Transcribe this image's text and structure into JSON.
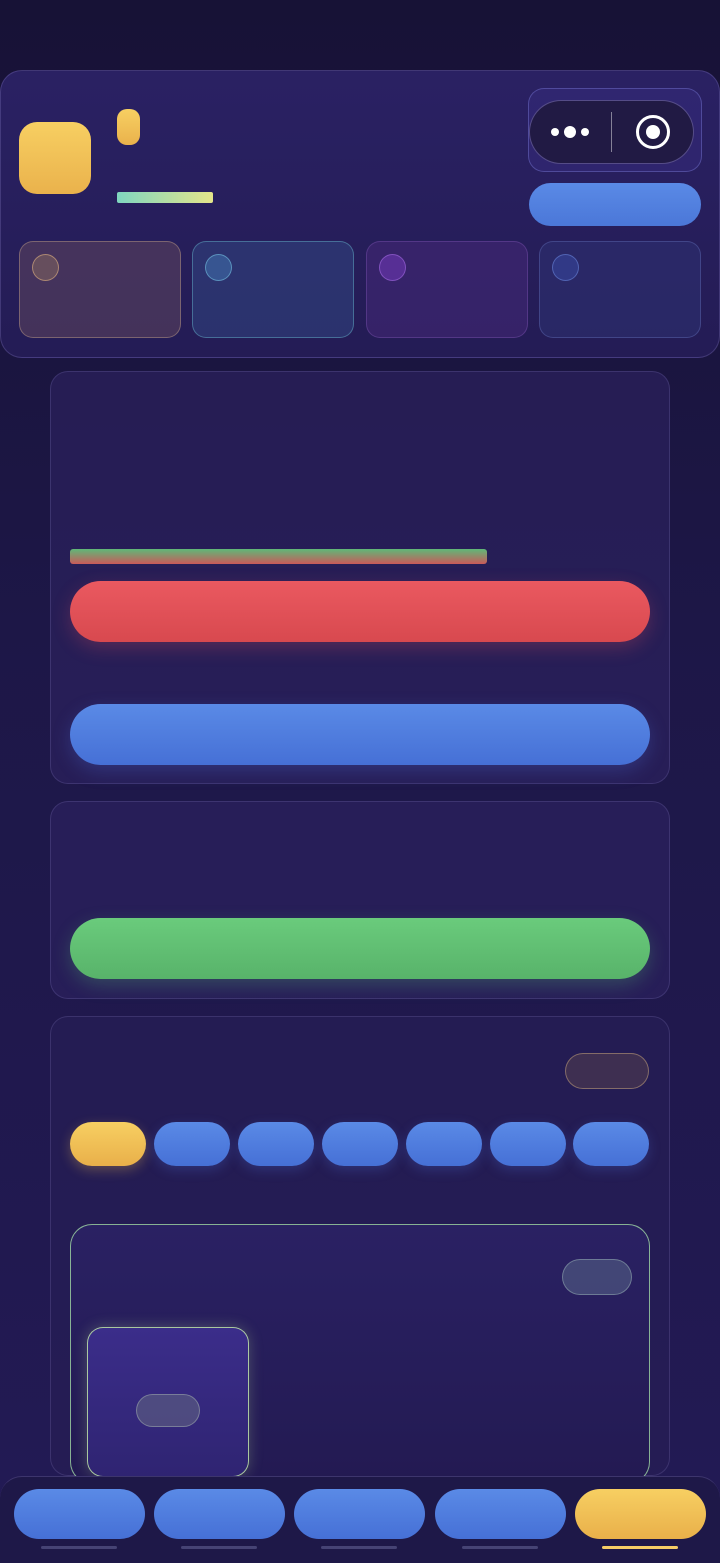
{
  "header": {
    "title": "",
    "action_label": "",
    "stats": [
      {
        "value": ""
      },
      {
        "value": ""
      },
      {
        "value": ""
      },
      {
        "value": ""
      }
    ]
  },
  "capsule": {
    "more_icon": "more-dots-icon",
    "close_icon": "target-circle-icon"
  },
  "task_panel": {
    "progress": 0.72,
    "primary_label": "",
    "secondary_label": ""
  },
  "reward_panel": {
    "button_label": ""
  },
  "schedule_panel": {
    "tag_label": "",
    "days": [
      {
        "label": "",
        "active": true
      },
      {
        "label": "",
        "active": false
      },
      {
        "label": "",
        "active": false
      },
      {
        "label": "",
        "active": false
      },
      {
        "label": "",
        "active": false
      },
      {
        "label": "",
        "active": false
      },
      {
        "label": "",
        "active": false
      }
    ],
    "card_tag": "",
    "slot_tag": ""
  },
  "tabs": [
    {
      "label": "",
      "active": false
    },
    {
      "label": "",
      "active": false
    },
    {
      "label": "",
      "active": false
    },
    {
      "label": "",
      "active": false
    },
    {
      "label": "",
      "active": true
    }
  ],
  "colors": {
    "accent_gold": "#f5c45a",
    "accent_blue": "#5282e0",
    "danger_red": "#e4535a",
    "success_green": "#63c476",
    "background": "#1d1747"
  }
}
